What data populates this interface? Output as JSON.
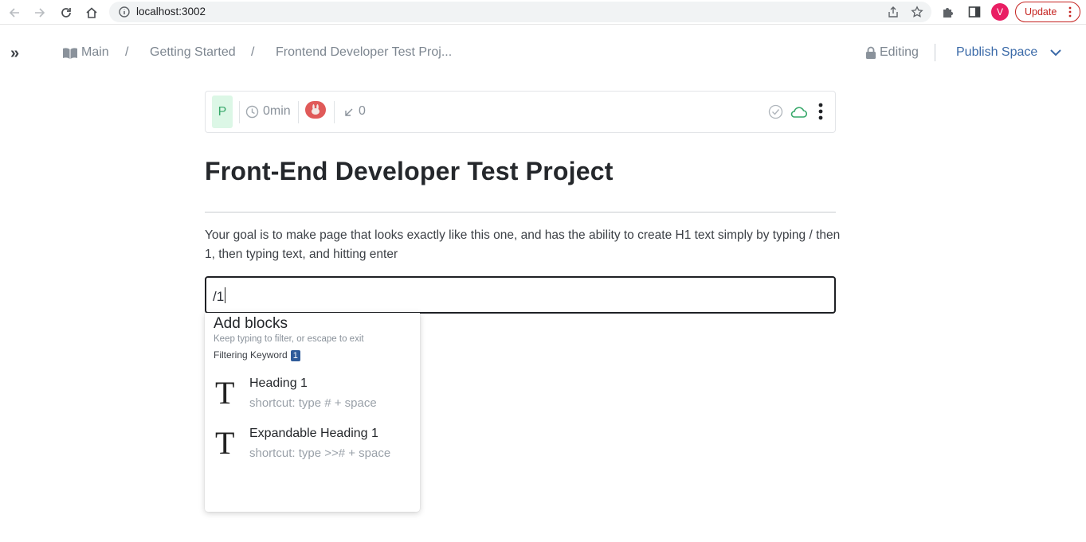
{
  "browser": {
    "url": "localhost:3002",
    "avatar_letter": "V",
    "update_label": "Update",
    "update_color": "#c5221f",
    "avatar_color": "#e91e63"
  },
  "header": {
    "expand_glyph": "»",
    "breadcrumbs": [
      {
        "label": "Main",
        "icon": "book-icon"
      },
      {
        "label": "Getting Started"
      },
      {
        "label": "Frontend Developer Test Proj..."
      }
    ],
    "separator": "/",
    "editing_label": "Editing",
    "publish_label": "Publish Space",
    "accent_color": "#3b6aa8"
  },
  "meta": {
    "page_initial": "P",
    "read_time": "0min",
    "links_count": "0",
    "status_icons": [
      "check-circle-icon",
      "cloud-icon",
      "more-vertical-icon"
    ]
  },
  "document": {
    "title": "Front-End Developer Test Project",
    "paragraph": "Your goal is to make page that looks exactly like this one, and has the ability to create H1 text simply by typing / then 1, then typing text, and hitting enter",
    "input_value": "/1"
  },
  "dropdown": {
    "title": "Add blocks",
    "hint": "Keep typing to filter, or escape to exit",
    "filter_label": "Filtering Keyword",
    "filter_keyword": "1",
    "items": [
      {
        "glyph": "T",
        "name": "Heading 1",
        "shortcut": "shortcut: type # + space"
      },
      {
        "glyph": "T",
        "name": "Expandable Heading 1",
        "shortcut": "shortcut: type >># + space"
      }
    ]
  }
}
